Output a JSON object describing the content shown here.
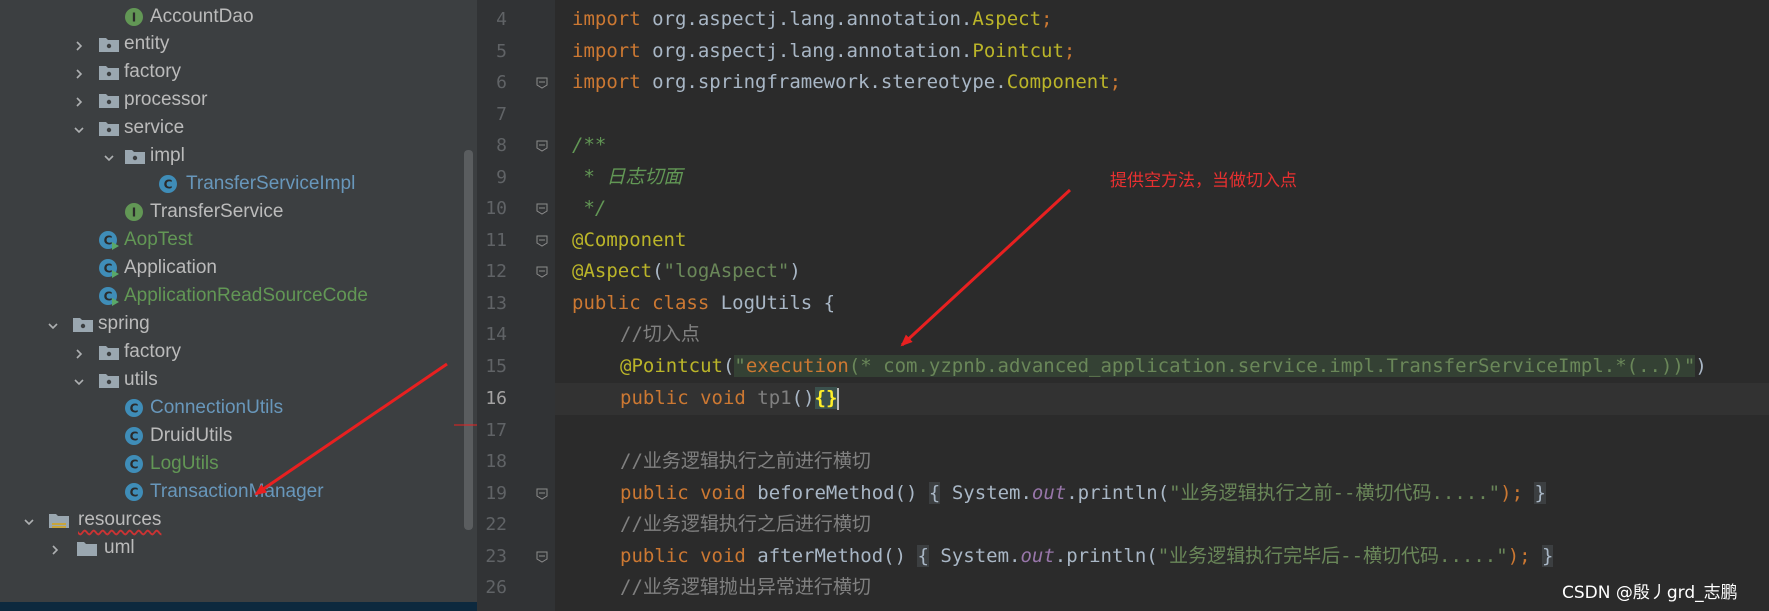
{
  "project_tree": {
    "items": [
      {
        "label": "AccountDao",
        "kind": "interface",
        "color": "#bbbbbb"
      },
      {
        "label": "entity",
        "kind": "package",
        "expanded": false
      },
      {
        "label": "factory",
        "kind": "package",
        "expanded": false
      },
      {
        "label": "processor",
        "kind": "package",
        "expanded": false
      },
      {
        "label": "service",
        "kind": "package",
        "expanded": true
      },
      {
        "label": "impl",
        "kind": "package",
        "expanded": true
      },
      {
        "label": "TransferServiceImpl",
        "kind": "class",
        "color": "#6897bb"
      },
      {
        "label": "TransferService",
        "kind": "interface",
        "color": "#bbbbbb"
      },
      {
        "label": "AopTest",
        "kind": "class-runnable",
        "color": "#629755"
      },
      {
        "label": "Application",
        "kind": "class-runnable",
        "color": "#bbbbbb"
      },
      {
        "label": "ApplicationReadSourceCode",
        "kind": "class-runnable",
        "color": "#629755"
      },
      {
        "label": "spring",
        "kind": "package",
        "expanded": true
      },
      {
        "label": "factory",
        "kind": "package",
        "expanded": false
      },
      {
        "label": "utils",
        "kind": "package",
        "expanded": true
      },
      {
        "label": "ConnectionUtils",
        "kind": "class",
        "color": "#6897bb"
      },
      {
        "label": "DruidUtils",
        "kind": "class",
        "color": "#bbbbbb"
      },
      {
        "label": "LogUtils",
        "kind": "class",
        "color": "#629755"
      },
      {
        "label": "TransactionManager",
        "kind": "class",
        "color": "#6897bb"
      },
      {
        "label": "resources",
        "kind": "resources-folder",
        "expanded": true
      },
      {
        "label": "uml",
        "kind": "folder",
        "expanded": false
      }
    ]
  },
  "editor": {
    "line_numbers": [
      "4",
      "5",
      "6",
      "7",
      "8",
      "9",
      "10",
      "11",
      "12",
      "13",
      "14",
      "15",
      "16",
      "17",
      "18",
      "19",
      "22",
      "23",
      "26"
    ],
    "current_line": "16",
    "code": {
      "l4": {
        "kw": "import",
        "pkg": " org.aspectj.lang.annotation.",
        "cls": "Aspect",
        "semi": ";"
      },
      "l5": {
        "kw": "import",
        "pkg": " org.aspectj.lang.annotation.",
        "cls": "Pointcut",
        "semi": ";"
      },
      "l6": {
        "kw": "import",
        "pkg": " org.springframework.stereotype.",
        "cls": "Component",
        "semi": ";"
      },
      "l8": {
        "doc": "/**"
      },
      "l9": {
        "doc": " * 日志切面"
      },
      "l10": {
        "doc": " */"
      },
      "l11": {
        "ann": "@Component"
      },
      "l12": {
        "ann": "@Aspect",
        "open": "(",
        "str": "\"logAspect\"",
        "close": ")"
      },
      "l13": {
        "kw1": "public",
        "kw2": "class",
        "name": " LogUtils {"
      },
      "l14": {
        "cmt": "//切入点"
      },
      "l15": {
        "ann": "@Pointcut",
        "open": "(",
        "q1": "\"",
        "exec": "execution",
        "expr": "(* com.yzpnb.advanced_application.service.impl.TransferServiceImpl.*(..))",
        "q2": "\"",
        "close": ")"
      },
      "l16": {
        "kw1": "public",
        "kw2": "void",
        "name": " tp1",
        "parens": "()",
        "brace": "{}"
      },
      "l18": {
        "cmt": "//业务逻辑执行之前进行横切"
      },
      "l19": {
        "kw1": "public",
        "kw2": "void",
        "name": " beforeMethod",
        "parens": "()",
        "ob": "{",
        "sys": " System.",
        "out": "out",
        "pr": ".println(",
        "str": "\"业务逻辑执行之前--横切代码.....\"",
        "end": ");",
        "cb": "}"
      },
      "l22": {
        "cmt": "//业务逻辑执行之后进行横切"
      },
      "l23": {
        "kw1": "public",
        "kw2": "void",
        "name": " afterMethod",
        "parens": "()",
        "ob": "{",
        "sys": " System.",
        "out": "out",
        "pr": ".println(",
        "str": "\"业务逻辑执行完毕后--横切代码.....\"",
        "end": ");",
        "cb": "}"
      },
      "l26": {
        "cmt": "//业务逻辑抛出异常进行横切"
      }
    }
  },
  "annotation_note": "提供空方法，当做切入点",
  "watermark": "CSDN @殷丿grd_志鹏",
  "colors": {
    "arrow": "#e82020"
  }
}
